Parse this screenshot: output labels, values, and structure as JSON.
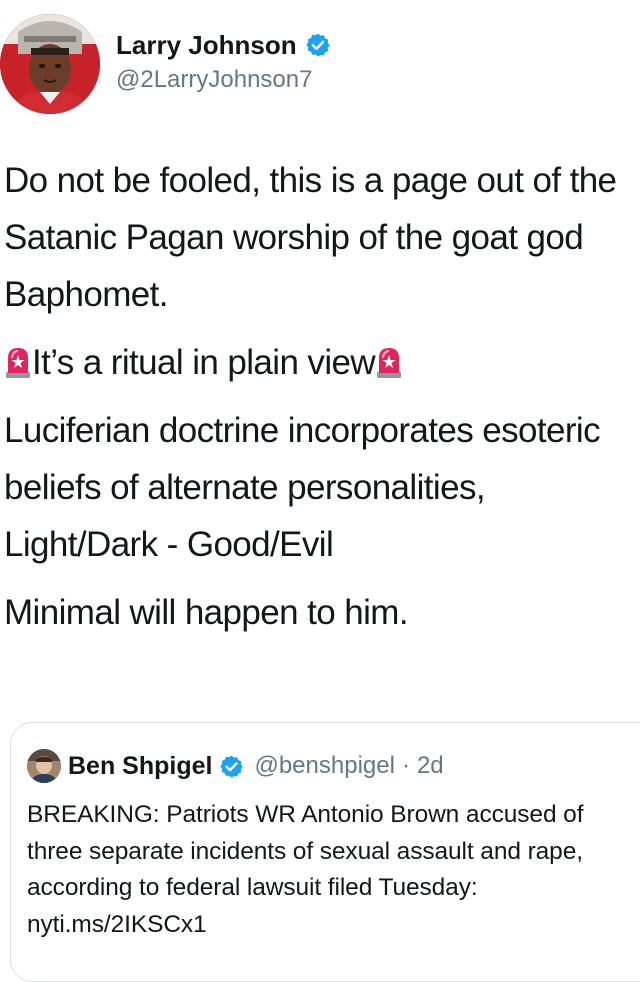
{
  "author": {
    "name": "Larry Johnson",
    "handle": "@2LarryJohnson7",
    "verified": true,
    "avatar": "avatar-football-player"
  },
  "tweet": {
    "paragraph_1": "Do not be fooled, this is a page out of the Satanic Pagan worship of the goat god Baphomet.",
    "paragraph_2_text": "It’s a ritual in plain view",
    "paragraph_2_icons": [
      "rotating-light-icon",
      "rotating-light-icon"
    ],
    "paragraph_3": "Luciferian doctrine incorporates esoteric beliefs of alternate personalities, Light/Dark - Good/Evil",
    "paragraph_4": "Minimal will happen to him."
  },
  "quoted_tweet": {
    "name": "Ben Shpigel",
    "handle": "@benshpigel",
    "separator": "·",
    "time": "2d",
    "verified": true,
    "text": "BREAKING: Patriots WR Antonio Brown accused of three separate incidents of sexual assault and rape, according to federal lawsuit filed Tuesday: nyti.ms/2IKSCx1"
  },
  "colors": {
    "text": "#14171a",
    "secondary_text": "#657786",
    "verified_blue": "#1da1f2",
    "border": "#d9dfe4",
    "alarm_red": "#e0245e"
  }
}
